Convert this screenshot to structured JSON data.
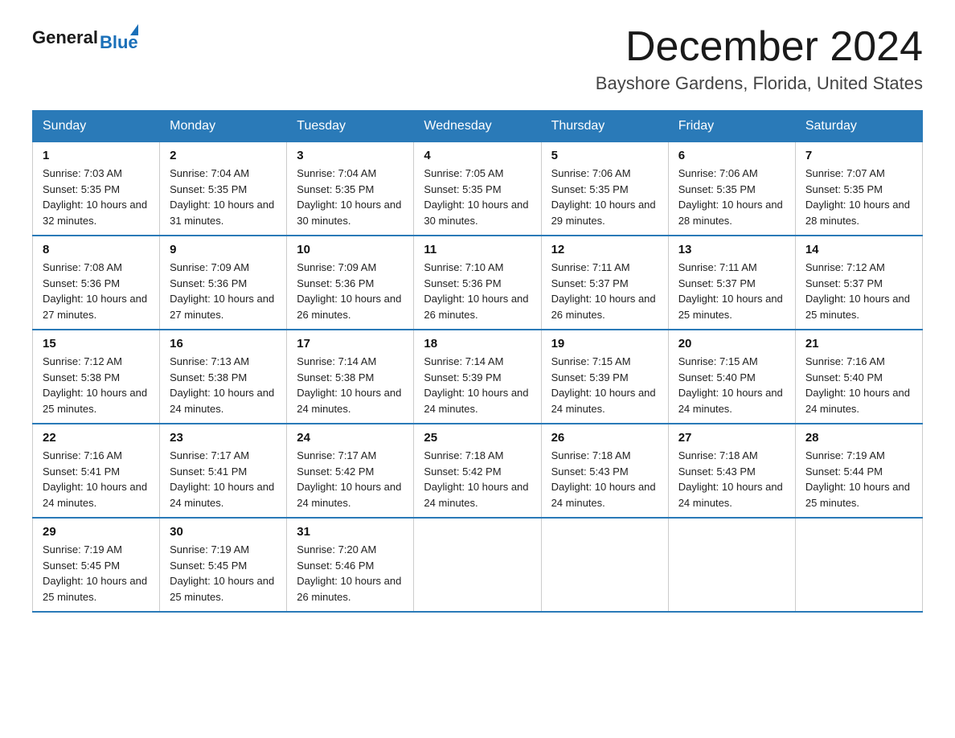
{
  "header": {
    "logo_general": "General",
    "logo_blue": "Blue",
    "title": "December 2024",
    "location": "Bayshore Gardens, Florida, United States"
  },
  "weekdays": [
    "Sunday",
    "Monday",
    "Tuesday",
    "Wednesday",
    "Thursday",
    "Friday",
    "Saturday"
  ],
  "weeks": [
    [
      {
        "day": "1",
        "sunrise": "7:03 AM",
        "sunset": "5:35 PM",
        "daylight": "10 hours and 32 minutes."
      },
      {
        "day": "2",
        "sunrise": "7:04 AM",
        "sunset": "5:35 PM",
        "daylight": "10 hours and 31 minutes."
      },
      {
        "day": "3",
        "sunrise": "7:04 AM",
        "sunset": "5:35 PM",
        "daylight": "10 hours and 30 minutes."
      },
      {
        "day": "4",
        "sunrise": "7:05 AM",
        "sunset": "5:35 PM",
        "daylight": "10 hours and 30 minutes."
      },
      {
        "day": "5",
        "sunrise": "7:06 AM",
        "sunset": "5:35 PM",
        "daylight": "10 hours and 29 minutes."
      },
      {
        "day": "6",
        "sunrise": "7:06 AM",
        "sunset": "5:35 PM",
        "daylight": "10 hours and 28 minutes."
      },
      {
        "day": "7",
        "sunrise": "7:07 AM",
        "sunset": "5:35 PM",
        "daylight": "10 hours and 28 minutes."
      }
    ],
    [
      {
        "day": "8",
        "sunrise": "7:08 AM",
        "sunset": "5:36 PM",
        "daylight": "10 hours and 27 minutes."
      },
      {
        "day": "9",
        "sunrise": "7:09 AM",
        "sunset": "5:36 PM",
        "daylight": "10 hours and 27 minutes."
      },
      {
        "day": "10",
        "sunrise": "7:09 AM",
        "sunset": "5:36 PM",
        "daylight": "10 hours and 26 minutes."
      },
      {
        "day": "11",
        "sunrise": "7:10 AM",
        "sunset": "5:36 PM",
        "daylight": "10 hours and 26 minutes."
      },
      {
        "day": "12",
        "sunrise": "7:11 AM",
        "sunset": "5:37 PM",
        "daylight": "10 hours and 26 minutes."
      },
      {
        "day": "13",
        "sunrise": "7:11 AM",
        "sunset": "5:37 PM",
        "daylight": "10 hours and 25 minutes."
      },
      {
        "day": "14",
        "sunrise": "7:12 AM",
        "sunset": "5:37 PM",
        "daylight": "10 hours and 25 minutes."
      }
    ],
    [
      {
        "day": "15",
        "sunrise": "7:12 AM",
        "sunset": "5:38 PM",
        "daylight": "10 hours and 25 minutes."
      },
      {
        "day": "16",
        "sunrise": "7:13 AM",
        "sunset": "5:38 PM",
        "daylight": "10 hours and 24 minutes."
      },
      {
        "day": "17",
        "sunrise": "7:14 AM",
        "sunset": "5:38 PM",
        "daylight": "10 hours and 24 minutes."
      },
      {
        "day": "18",
        "sunrise": "7:14 AM",
        "sunset": "5:39 PM",
        "daylight": "10 hours and 24 minutes."
      },
      {
        "day": "19",
        "sunrise": "7:15 AM",
        "sunset": "5:39 PM",
        "daylight": "10 hours and 24 minutes."
      },
      {
        "day": "20",
        "sunrise": "7:15 AM",
        "sunset": "5:40 PM",
        "daylight": "10 hours and 24 minutes."
      },
      {
        "day": "21",
        "sunrise": "7:16 AM",
        "sunset": "5:40 PM",
        "daylight": "10 hours and 24 minutes."
      }
    ],
    [
      {
        "day": "22",
        "sunrise": "7:16 AM",
        "sunset": "5:41 PM",
        "daylight": "10 hours and 24 minutes."
      },
      {
        "day": "23",
        "sunrise": "7:17 AM",
        "sunset": "5:41 PM",
        "daylight": "10 hours and 24 minutes."
      },
      {
        "day": "24",
        "sunrise": "7:17 AM",
        "sunset": "5:42 PM",
        "daylight": "10 hours and 24 minutes."
      },
      {
        "day": "25",
        "sunrise": "7:18 AM",
        "sunset": "5:42 PM",
        "daylight": "10 hours and 24 minutes."
      },
      {
        "day": "26",
        "sunrise": "7:18 AM",
        "sunset": "5:43 PM",
        "daylight": "10 hours and 24 minutes."
      },
      {
        "day": "27",
        "sunrise": "7:18 AM",
        "sunset": "5:43 PM",
        "daylight": "10 hours and 24 minutes."
      },
      {
        "day": "28",
        "sunrise": "7:19 AM",
        "sunset": "5:44 PM",
        "daylight": "10 hours and 25 minutes."
      }
    ],
    [
      {
        "day": "29",
        "sunrise": "7:19 AM",
        "sunset": "5:45 PM",
        "daylight": "10 hours and 25 minutes."
      },
      {
        "day": "30",
        "sunrise": "7:19 AM",
        "sunset": "5:45 PM",
        "daylight": "10 hours and 25 minutes."
      },
      {
        "day": "31",
        "sunrise": "7:20 AM",
        "sunset": "5:46 PM",
        "daylight": "10 hours and 26 minutes."
      },
      null,
      null,
      null,
      null
    ]
  ]
}
